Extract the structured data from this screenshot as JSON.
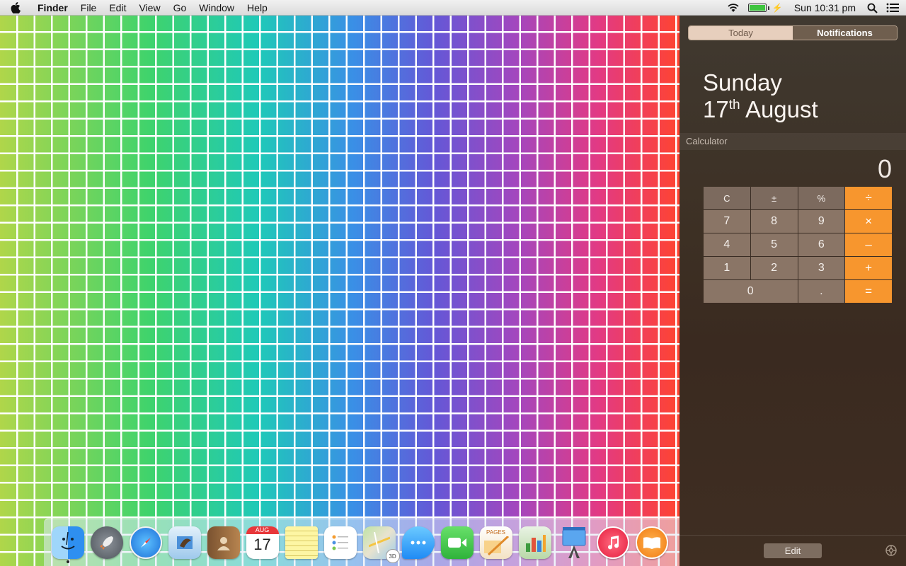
{
  "menubar": {
    "app_name": "Finder",
    "menus": [
      "File",
      "Edit",
      "View",
      "Go",
      "Window",
      "Help"
    ],
    "clock": "Sun 10:31 pm",
    "icons": [
      "apple-icon",
      "wifi-icon",
      "battery-icon",
      "search-icon",
      "list-icon"
    ]
  },
  "notification_center": {
    "tabs": {
      "today": "Today",
      "notifications": "Notifications"
    },
    "date": {
      "weekday": "Sunday",
      "day": "17",
      "ordinal": "th",
      "month": "August"
    },
    "widget_title": "Calculator",
    "calculator": {
      "display": "0",
      "keys": [
        "C",
        "±",
        "%",
        "÷",
        "7",
        "8",
        "9",
        "×",
        "4",
        "5",
        "6",
        "–",
        "1",
        "2",
        "3",
        "+",
        "0",
        ".",
        "="
      ]
    },
    "edit_label": "Edit"
  },
  "dock": {
    "apps": [
      {
        "name": "Finder",
        "icon": "finder-icon"
      },
      {
        "name": "Launchpad",
        "icon": "rocket-icon"
      },
      {
        "name": "Safari",
        "icon": "compass-icon"
      },
      {
        "name": "Mail",
        "icon": "mail-icon"
      },
      {
        "name": "Contacts",
        "icon": "contacts-icon"
      },
      {
        "name": "Calendar",
        "icon": "calendar-icon",
        "month": "AUG",
        "day": "17"
      },
      {
        "name": "Notes",
        "icon": "notes-icon"
      },
      {
        "name": "Reminders",
        "icon": "reminders-icon"
      },
      {
        "name": "Maps",
        "icon": "map-icon",
        "badge": "3D"
      },
      {
        "name": "Messages",
        "icon": "messages-icon"
      },
      {
        "name": "FaceTime",
        "icon": "facetime-icon"
      },
      {
        "name": "Pages",
        "icon": "pages-icon",
        "label": "PAGES"
      },
      {
        "name": "Numbers",
        "icon": "numbers-icon"
      },
      {
        "name": "Keynote",
        "icon": "keynote-icon"
      },
      {
        "name": "iTunes",
        "icon": "music-icon"
      },
      {
        "name": "iBooks",
        "icon": "book-icon"
      }
    ]
  },
  "colors": {
    "nc_background": "#3d3024",
    "calc_key": "#8a7566",
    "calc_operator": "#f7962e"
  }
}
